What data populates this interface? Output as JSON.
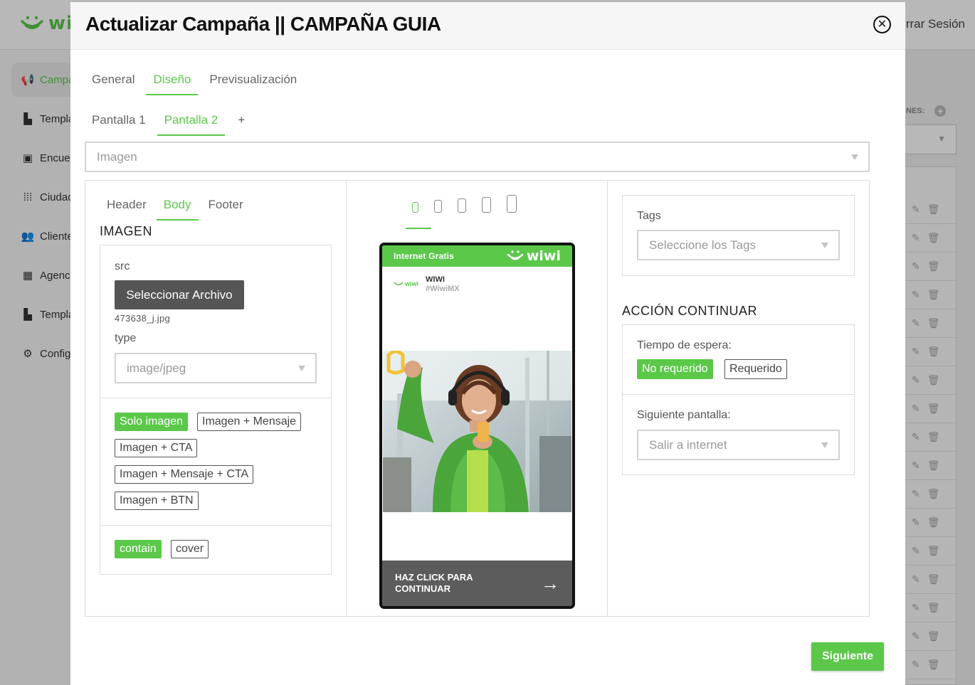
{
  "background": {
    "logo_text": "wi",
    "logout_label": "rrar Sesión",
    "sidebar": [
      {
        "label": "Campa",
        "icon": "megaphone-icon",
        "glyph": "📢"
      },
      {
        "label": "Templa",
        "icon": "template-icon",
        "glyph": "▙"
      },
      {
        "label": "Encues",
        "icon": "clipboard-icon",
        "glyph": "▣"
      },
      {
        "label": "Ciudad",
        "icon": "grid-dots-icon",
        "glyph": "⁞⁞⁞"
      },
      {
        "label": "Cliente",
        "icon": "users-icon",
        "glyph": "👥"
      },
      {
        "label": "Agenc",
        "icon": "building-icon",
        "glyph": "▦"
      },
      {
        "label": "Templa",
        "icon": "template-icon",
        "glyph": "▙"
      },
      {
        "label": "Config",
        "icon": "gear-icon",
        "glyph": "⚙"
      }
    ],
    "right_label": "NES:",
    "row_count": 17
  },
  "modal": {
    "title": "Actualizar Campaña || CAMPAÑA GUIA",
    "close_glyph": "✕",
    "main_tabs": [
      "General",
      "Diseño",
      "Previsualización"
    ],
    "active_main_tab": 1,
    "screen_tabs": [
      "Pantalla 1",
      "Pantalla 2"
    ],
    "add_screen_label": "+",
    "active_screen_tab": 1,
    "element_select": "Imagen",
    "left": {
      "sub_tabs": [
        "Header",
        "Body",
        "Footer"
      ],
      "active_sub_tab": 1,
      "section_title": "IMAGEN",
      "src_label": "src",
      "select_file_button": "Seleccionar Archivo",
      "file_name": "473638_j.jpg",
      "type_label": "type",
      "type_value": "image/jpeg",
      "layout_options": [
        "Solo imagen",
        "Imagen + Mensaje",
        "Imagen + CTA",
        "Imagen + Mensaje + CTA",
        "Imagen + BTN"
      ],
      "active_layout": "Solo imagen",
      "fit_options": [
        "contain",
        "cover"
      ],
      "active_fit": "contain"
    },
    "preview": {
      "device_icons": [
        "device-phone-xs-icon",
        "device-phone-sm-icon",
        "device-phone-md-icon",
        "device-phone-lg-icon",
        "device-phone-xl-icon"
      ],
      "active_device": 0,
      "top_bar_text": "Internet Gratis",
      "brand_text": "wiwi",
      "mini_brand": "wiwi",
      "business_name": "WIWI",
      "hashtag": "#WiwiMX",
      "cta_text": "HAZ CLICK PARA CONTINUAR",
      "cta_arrow": "→"
    },
    "right": {
      "tags_label": "Tags",
      "tags_placeholder": "Seleccione los Tags",
      "action_title": "ACCIÓN CONTINUAR",
      "wait_label": "Tiempo de espera:",
      "wait_options": [
        "No requerido",
        "Requerido"
      ],
      "active_wait": "No requerido",
      "next_screen_label": "Siguiente pantalla:",
      "next_screen_value": "Salir a internet"
    },
    "next_button": "Siguiente"
  },
  "colors": {
    "accent": "#5bc84a",
    "dark_button": "#555555",
    "cta_bg": "#5c5c5c"
  }
}
